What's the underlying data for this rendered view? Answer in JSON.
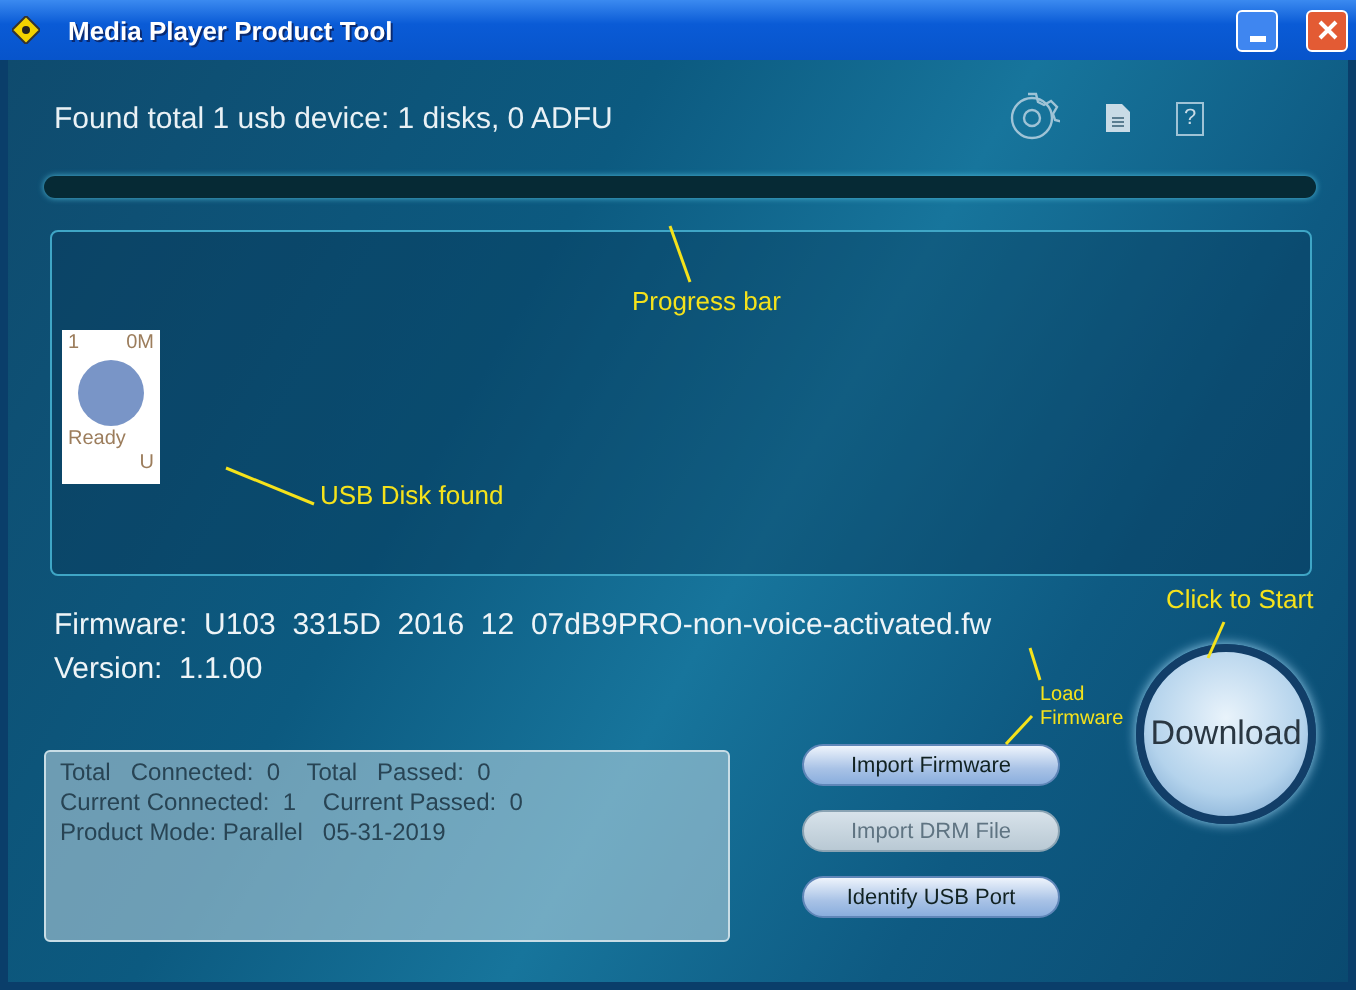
{
  "window": {
    "title": "Media Player Product Tool"
  },
  "status": "Found total 1 usb device: 1 disks, 0 ADFU",
  "help_icon": "?",
  "progress": {
    "level": 0
  },
  "devices": [
    {
      "number": "1",
      "size": "0M",
      "state": "Ready",
      "letter": "U"
    }
  ],
  "firmware": {
    "label": "Firmware:",
    "value": "U103  3315D  2016  12  07dB9PRO-non-voice-activated.fw"
  },
  "version": {
    "label": "Version:",
    "value": "1.1.00"
  },
  "stats": [
    "Total   Connected:  0    Total   Passed:  0",
    "Current Connected:  1    Current Passed:  0",
    "Product Mode: Parallel   05-31-2019"
  ],
  "buttons": [
    {
      "label": "Import Firmware",
      "disabled": false
    },
    {
      "label": "Import DRM File",
      "disabled": true
    },
    {
      "label": "Identify USB Port",
      "disabled": false
    }
  ],
  "download": {
    "label": "Download"
  },
  "annotations": [
    {
      "text": "Progress bar",
      "kind": "progress"
    },
    {
      "text": "USB Disk found",
      "kind": "disk"
    },
    {
      "text": "Load Firmware",
      "kind": "load"
    },
    {
      "text": "Click to Start",
      "kind": "start"
    }
  ]
}
